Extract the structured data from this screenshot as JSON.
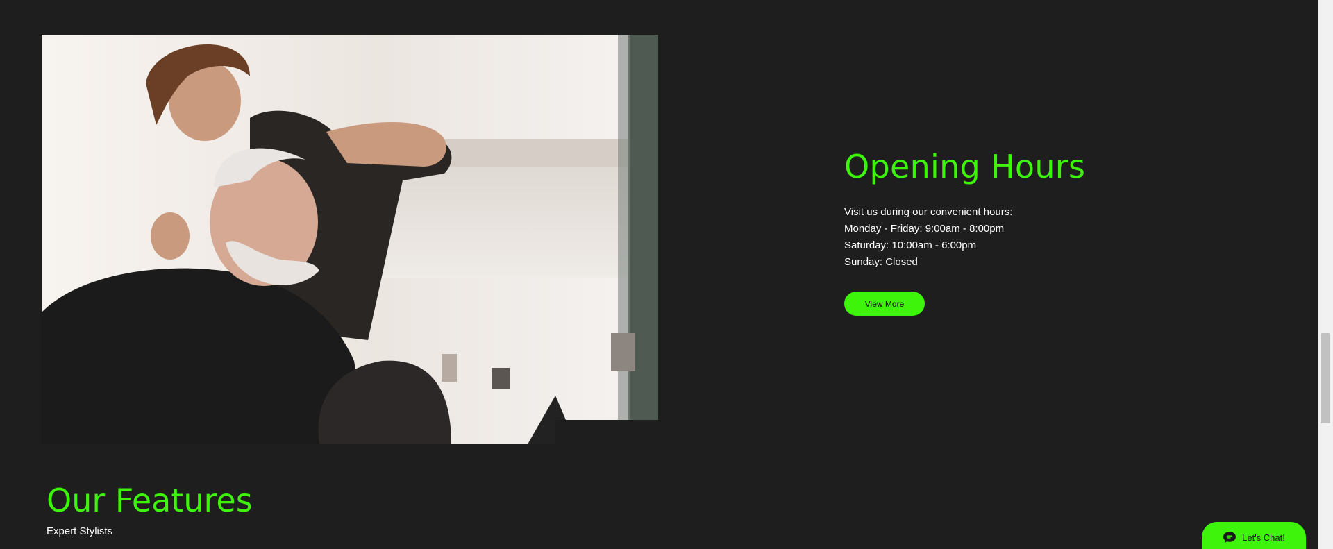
{
  "hours": {
    "title": "Opening Hours",
    "lines": [
      "Visit us during our convenient hours:",
      "Monday - Friday: 9:00am - 8:00pm",
      "Saturday: 10:00am - 6:00pm",
      "Sunday: Closed"
    ],
    "button_label": "View More"
  },
  "features": {
    "title": "Our Features",
    "first_item": "Expert Stylists"
  },
  "chat": {
    "label": "Let's Chat!",
    "icon": "chat-bubble-icon"
  },
  "colors": {
    "background": "#1e1e1e",
    "accent": "#3df40a",
    "text": "#ffffff"
  },
  "photo": {
    "subject": "barber-cutting-hair-photo"
  }
}
